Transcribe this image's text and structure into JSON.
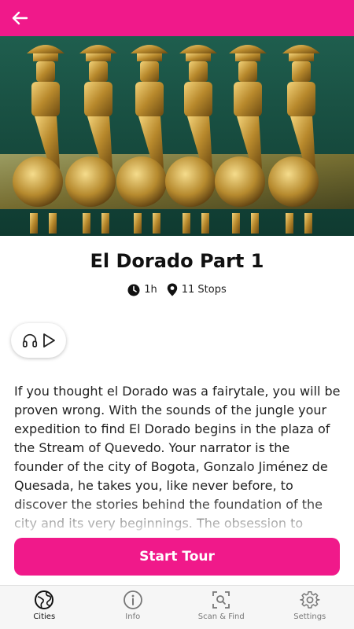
{
  "colors": {
    "accent": "#f0198a"
  },
  "header": {
    "back_icon": "arrow-left-icon"
  },
  "hero": {
    "image_icon": "gold-figures-artifact-image"
  },
  "tour": {
    "title": "El Dorado Part 1",
    "duration": "1h",
    "stops": "11 Stops",
    "description": "If you thought el Dorado was a fairytale, you will be proven wrong. With the sounds of the jungle your expedition to find El Dorado begins in the plaza of the Stream of Quevedo. Your narrator is the founder of the city of Bogota, Gonzalo Jiménez de Quesada, he takes you, like never before, to discover the stories behind the foundation of the city and its very beginnings. The obsession to discover El"
  },
  "audio": {
    "icons": [
      "headphones-icon",
      "play-icon"
    ]
  },
  "actions": {
    "start_label": "Start Tour"
  },
  "nav": {
    "items": [
      {
        "label": "Cities",
        "icon": "globe-icon",
        "active": true
      },
      {
        "label": "Info",
        "icon": "info-icon",
        "active": false
      },
      {
        "label": "Scan & Find",
        "icon": "scan-icon",
        "active": false
      },
      {
        "label": "Settings",
        "icon": "gear-icon",
        "active": false
      }
    ]
  }
}
